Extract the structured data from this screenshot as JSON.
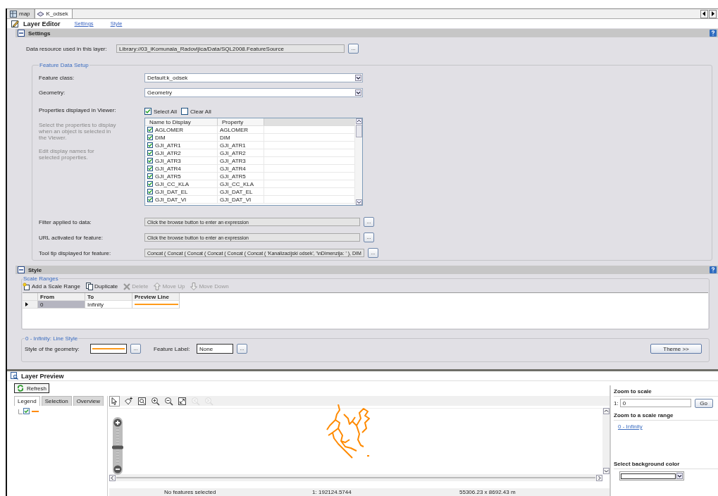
{
  "tabs": [
    {
      "label": "map",
      "kind": "map",
      "selected": false
    },
    {
      "label": "K_odsek",
      "kind": "layer",
      "selected": true
    }
  ],
  "editor": {
    "title": "Layer Editor",
    "links": [
      "Settings",
      "Style"
    ]
  },
  "settings": {
    "title": "Settings",
    "expanded": true,
    "browse": "...",
    "data_resource": {
      "label": "Data resource used in this layer:",
      "value": "Library://03_iKomunala_Radovljica/Data/SQL2008.FeatureSource"
    },
    "feature_data_setup": {
      "legend": "Feature Data Setup",
      "feature_class": {
        "label": "Feature class:",
        "value": "Default:k_odsek"
      },
      "geometry": {
        "label": "Geometry:",
        "value": "Geometry"
      },
      "properties_label": "Properties displayed in Viewer:",
      "select_all": {
        "label": "Select All",
        "checked": true
      },
      "clear_all": {
        "label": "Clear All",
        "checked": false
      },
      "help_text": [
        "Select the properties to display when an object is selected in the Viewer.",
        "Edit display names for selected properties."
      ],
      "columns": [
        "Name to Display",
        "Property"
      ],
      "rows": [
        {
          "name": "AGLOMER",
          "property": "AGLOMER",
          "checked": true
        },
        {
          "name": "DIM",
          "property": "DIM",
          "checked": true
        },
        {
          "name": "GJI_ATR1",
          "property": "GJI_ATR1",
          "checked": true
        },
        {
          "name": "GJI_ATR2",
          "property": "GJI_ATR2",
          "checked": true
        },
        {
          "name": "GJI_ATR3",
          "property": "GJI_ATR3",
          "checked": true
        },
        {
          "name": "GJI_ATR4",
          "property": "GJI_ATR4",
          "checked": true
        },
        {
          "name": "GJI_ATR5",
          "property": "GJI_ATR5",
          "checked": true
        },
        {
          "name": "GJI_CC_KLA",
          "property": "GJI_CC_KLA",
          "checked": true
        },
        {
          "name": "GJI_DAT_EL",
          "property": "GJI_DAT_EL",
          "checked": true
        },
        {
          "name": "GJI_DAT_VI",
          "property": "GJI_DAT_VI",
          "checked": true
        }
      ],
      "expressions": [
        {
          "label": "Filter applied to data:",
          "value": "Click the browse button to enter an expression"
        },
        {
          "label": "URL activated for feature:",
          "value": "Click the browse button to enter an expression"
        },
        {
          "label": "Tool tip displayed for feature:",
          "value": "Concat ( Concat ( Concat ( Concat ( Concat ( Concat ( 'Kanalizacijski odsek', '\\nDimenzija: ' ),  DIM"
        }
      ]
    }
  },
  "style": {
    "title": "Style",
    "expanded": true,
    "scale_ranges": {
      "legend": "Scale Ranges",
      "toolbar": [
        {
          "kind": "add",
          "label": "Add a Scale Range",
          "disabled": false
        },
        {
          "kind": "duplicate",
          "label": "Duplicate",
          "disabled": false
        },
        {
          "kind": "delete",
          "label": "Delete",
          "disabled": true
        },
        {
          "kind": "move-up",
          "label": "Move Up",
          "disabled": true
        },
        {
          "kind": "move-down",
          "label": "Move Down",
          "disabled": true
        }
      ],
      "columns": [
        "From",
        "To",
        "Preview Line"
      ],
      "rows": [
        {
          "from": "0",
          "to": "Infinity",
          "selected": true
        }
      ]
    },
    "line_style": {
      "legend": "0 - Infinity: Line Style",
      "geometry_label": "Style of the geometry:",
      "feature_label": "Feature Label:",
      "feature_label_value": "None",
      "theme_button": "Theme >>"
    }
  },
  "preview": {
    "title": "Layer Preview",
    "refresh": "Refresh",
    "tabs": [
      {
        "label": "Legend",
        "selected": true
      },
      {
        "label": "Selection",
        "selected": false
      },
      {
        "label": "Overview",
        "selected": false
      }
    ],
    "legend_item": {
      "checked": true
    },
    "map_tools": [
      {
        "kind": "pointer",
        "disabled": false
      },
      {
        "kind": "select-add",
        "disabled": false
      },
      {
        "kind": "zoom-box",
        "disabled": false
      },
      {
        "kind": "zoom-in",
        "disabled": false
      },
      {
        "kind": "zoom-out",
        "disabled": false
      },
      {
        "kind": "extents",
        "disabled": false
      },
      {
        "kind": "previous",
        "disabled": true
      },
      {
        "kind": "next",
        "disabled": true
      }
    ],
    "zoom_slider": {
      "level": 0.47
    },
    "status": {
      "selection": "No features selected",
      "scale_prefix": "1:",
      "scale": "192124.5744",
      "size": "55306.23 x 8692.43 m"
    },
    "side": {
      "zoom_to_scale": "Zoom to scale",
      "scale_prefix": "1:",
      "scale_value": "0",
      "go": "Go",
      "zoom_to_range": "Zoom to a scale range",
      "range_link": "0 - Infinity",
      "background_color": "Select background color"
    }
  }
}
